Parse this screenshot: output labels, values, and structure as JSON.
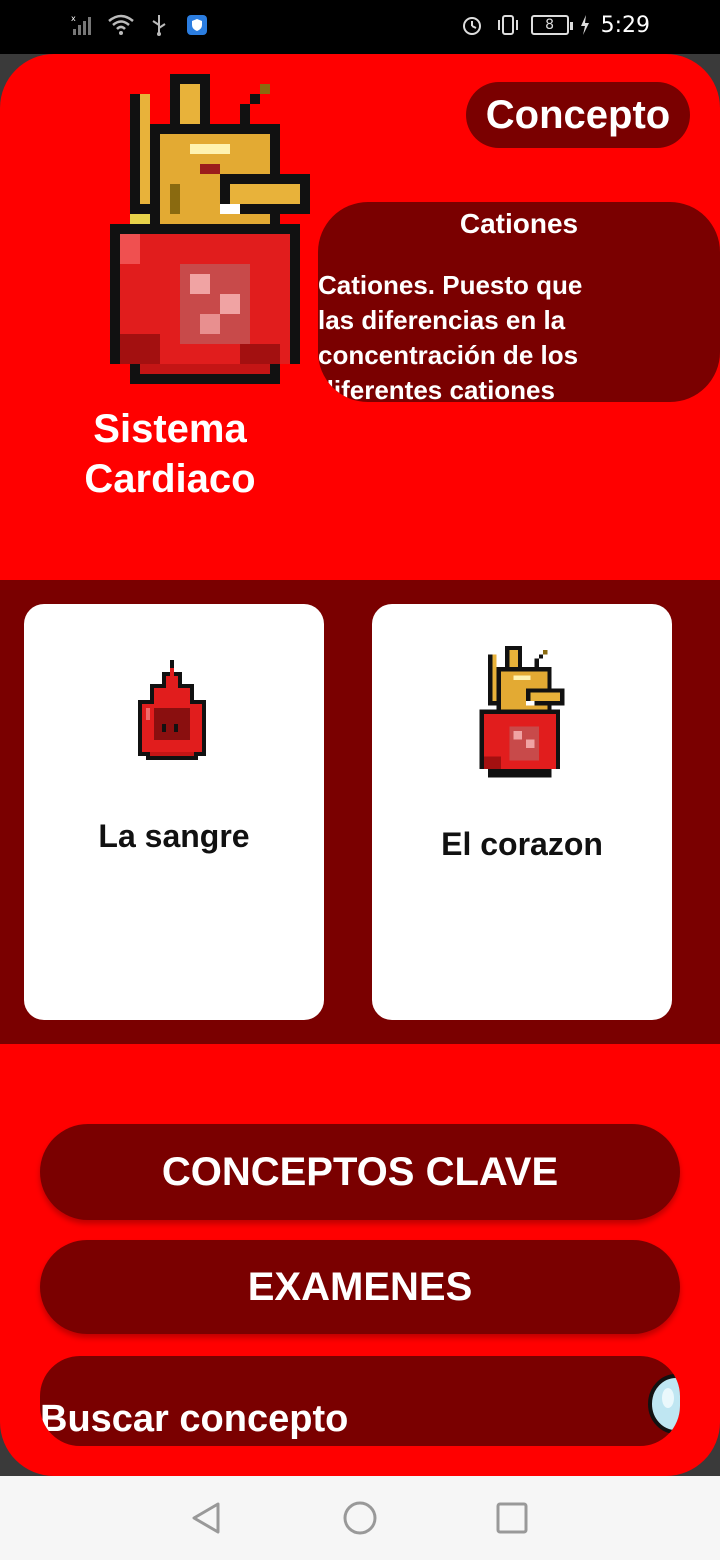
{
  "status_bar": {
    "time": "5:29",
    "battery_level": "8",
    "icons": [
      "signal-icon",
      "wifi-icon",
      "usb-icon",
      "shield-app-icon",
      "alarm-icon",
      "vibrate-icon",
      "battery-icon",
      "charging-icon"
    ]
  },
  "header": {
    "section_title": "Sistema Cardiaco",
    "concept_button_label": "Concepto"
  },
  "concept_card": {
    "title": "Cationes",
    "body": "Cationes. Puesto que las diferencias en la concentración de los diferentes cationes tanto"
  },
  "categories": [
    {
      "label": "La sangre",
      "icon": "blood-drop-icon"
    },
    {
      "label": "El corazon",
      "icon": "heart-crown-icon"
    }
  ],
  "menu": {
    "key_concepts_label": "CONCEPTOS CLAVE",
    "exams_label": "EXAMENES"
  },
  "search": {
    "placeholder": "Buscar concepto",
    "icon": "search-icon"
  },
  "nav_bar": {
    "icons": [
      "back-icon",
      "home-icon",
      "recents-icon"
    ]
  },
  "colors": {
    "background_red": "#ff0000",
    "dark_red": "#7a0000",
    "card_white": "#ffffff",
    "text_white": "#ffffff"
  }
}
